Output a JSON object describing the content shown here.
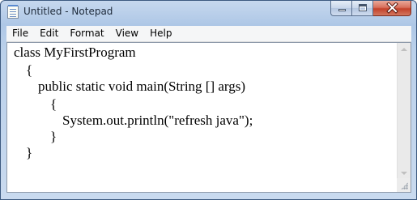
{
  "window": {
    "title": "Untitled - Notepad"
  },
  "menu": {
    "items": [
      {
        "label": "File"
      },
      {
        "label": "Edit"
      },
      {
        "label": "Format"
      },
      {
        "label": "View"
      },
      {
        "label": "Help"
      }
    ]
  },
  "editor": {
    "lines": [
      "class MyFirstProgram",
      "{",
      "public static void main(String [] args)",
      "{",
      "System.out.println(\"refresh java\");",
      "}",
      "}"
    ]
  },
  "icons": {
    "app": "notepad-icon",
    "minimize": "minimize-icon",
    "maximize": "maximize-icon",
    "close": "close-icon",
    "scroll_up": "scroll-up-arrow-icon",
    "scroll_down": "scroll-down-arrow-icon",
    "size_grip": "size-grip-icon"
  },
  "colors": {
    "title_bar": "#b9cfe9",
    "close_button": "#c4412a",
    "editor_background": "#ffffff",
    "text": "#000000"
  }
}
